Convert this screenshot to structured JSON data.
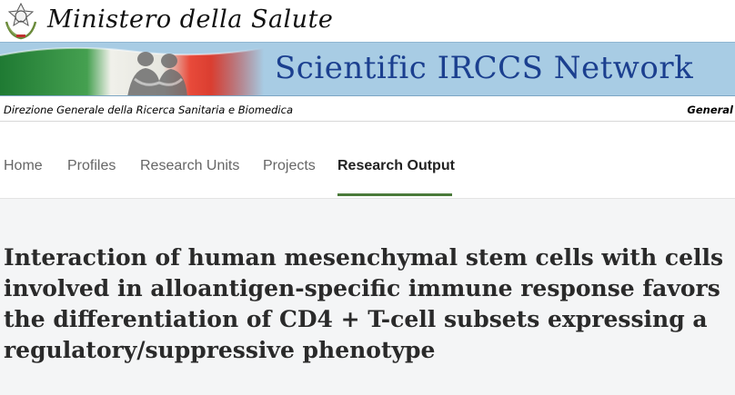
{
  "header": {
    "ministry_name": "Ministero della Salute",
    "banner_title": "Scientific IRCCS Network",
    "directorate": "Direzione Generale della Ricerca Sanitaria e Biomedica",
    "right_label": "General"
  },
  "nav": {
    "items": [
      {
        "label": "Home"
      },
      {
        "label": "Profiles"
      },
      {
        "label": "Research Units"
      },
      {
        "label": "Projects"
      },
      {
        "label": "Research Output"
      }
    ],
    "active_index": 4
  },
  "main": {
    "title": "Interaction of human mesenchymal stem cells with cells involved in alloantigen-specific immune response favors the differentiation of CD4 + T-cell subsets expressing a regulatory/suppressive phenotype"
  },
  "colors": {
    "banner_bg": "#a8cce4",
    "banner_title": "#1b3f8f",
    "active_underline": "#4a7a3a",
    "flag_green": "#2e8b3e",
    "flag_red": "#d92b2b"
  }
}
